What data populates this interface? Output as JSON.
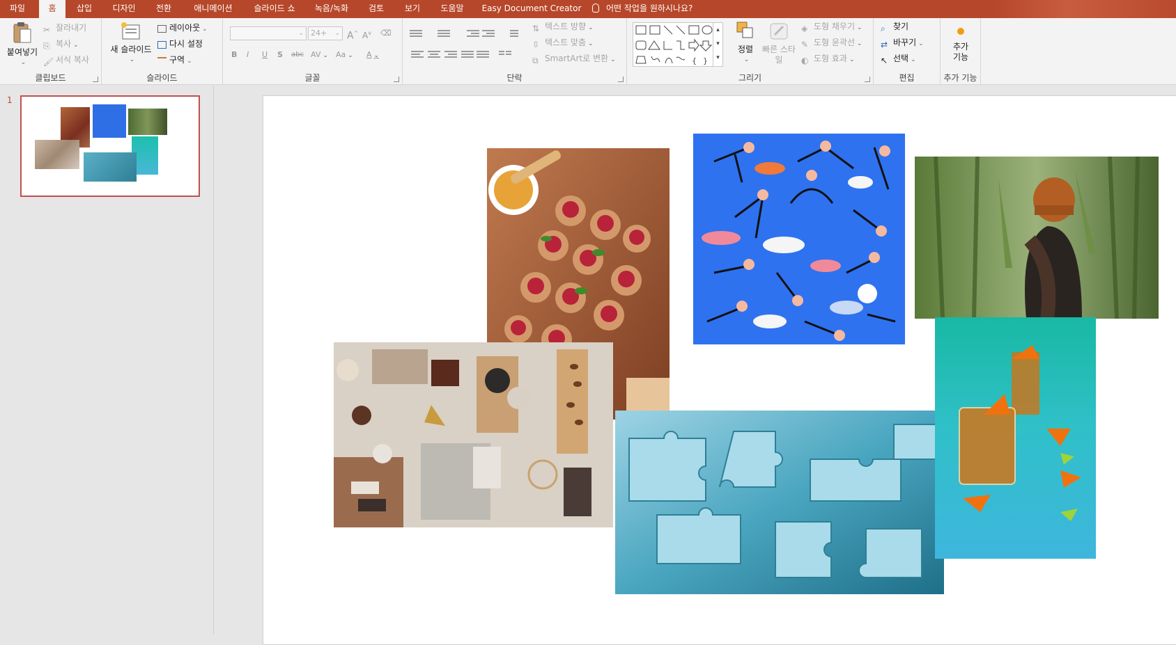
{
  "tabs": [
    {
      "label": "파일"
    },
    {
      "label": "홈",
      "active": true
    },
    {
      "label": "삽입"
    },
    {
      "label": "디자인"
    },
    {
      "label": "전환"
    },
    {
      "label": "애니메이션"
    },
    {
      "label": "슬라이드 쇼"
    },
    {
      "label": "녹음/녹화"
    },
    {
      "label": "검토"
    },
    {
      "label": "보기"
    },
    {
      "label": "도움말"
    },
    {
      "label": "Easy Document Creator"
    }
  ],
  "tell_me": "어떤 작업을 원하시나요?",
  "ribbon": {
    "clipboard": {
      "label": "클립보드",
      "paste": "붙여넣기",
      "cut": "잘라내기",
      "copy": "복사",
      "format_painter": "서식 복사"
    },
    "slides": {
      "label": "슬라이드",
      "new_slide": "새 슬라이드",
      "layout": "레이아웃",
      "reset": "다시 설정",
      "section": "구역"
    },
    "font": {
      "label": "글꼴",
      "size": "24+"
    },
    "paragraph": {
      "label": "단락",
      "text_direction": "텍스트 방향",
      "align_text": "텍스트 맞춤",
      "smartart": "SmartArt로 변환"
    },
    "drawing": {
      "label": "그리기",
      "arrange": "정렬",
      "quick_styles": "빠른 스타일",
      "shape_fill": "도형 채우기",
      "shape_outline": "도형 윤곽선",
      "shape_effects": "도형 효과"
    },
    "editing": {
      "label": "편집",
      "find": "찾기",
      "replace": "바꾸기",
      "select": "선택"
    },
    "addins": {
      "label": "추가 기능",
      "button": "추가 기능"
    }
  },
  "slide_panel": {
    "slide_number": "1"
  },
  "colors": {
    "accent": "#b7472a",
    "ribbon_bg": "#f3f3f3",
    "canvas": "#e6e6e6"
  }
}
